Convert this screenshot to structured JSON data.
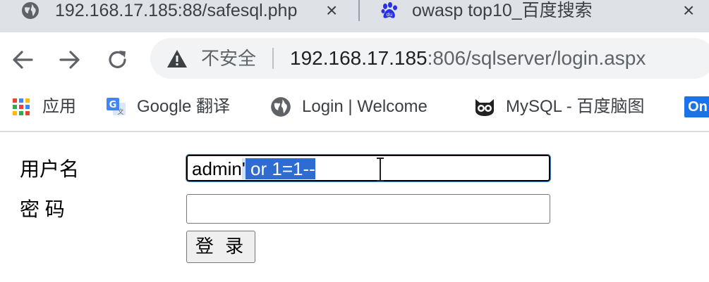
{
  "browser": {
    "tabs": [
      {
        "favicon": "globe-icon",
        "title": "192.168.17.185:88/safesql.php",
        "close_label": "×"
      },
      {
        "favicon": "baidu-paw-icon",
        "title": "owasp top10_百度搜索",
        "close_label": "×"
      }
    ],
    "toolbar": {
      "back_icon": "back-arrow-icon",
      "forward_icon": "forward-arrow-icon",
      "reload_icon": "reload-icon"
    },
    "omnibox": {
      "security_icon": "warning-triangle-icon",
      "security_label": "不安全",
      "url_host": "192.168.17.185",
      "url_rest": ":806/sqlserver/login.aspx"
    },
    "bookmarks": [
      {
        "icon": "apps-grid-icon",
        "label": "应用"
      },
      {
        "icon": "google-translate-icon",
        "label": "Google 翻译"
      },
      {
        "icon": "globe-icon",
        "label": "Login | Welcome"
      },
      {
        "icon": "baidu-brainmap-icon",
        "label": "MySQL - 百度脑图"
      },
      {
        "icon": "on-badge-icon",
        "label": "On"
      }
    ]
  },
  "form": {
    "username_label": "用户名",
    "password_label": "密 码",
    "username_value_plain": "admin",
    "username_value_selected_light": "'",
    "username_value_selected": " or 1=1--",
    "password_value": "",
    "submit_label": "登 录"
  },
  "colors": {
    "tabstrip_bg": "#dee1e6",
    "omnibox_bg": "#f1f3f4",
    "selection_bg": "#2f6cd1",
    "selection_light": "#cfe3fb",
    "on_badge": "#1a73e8"
  }
}
